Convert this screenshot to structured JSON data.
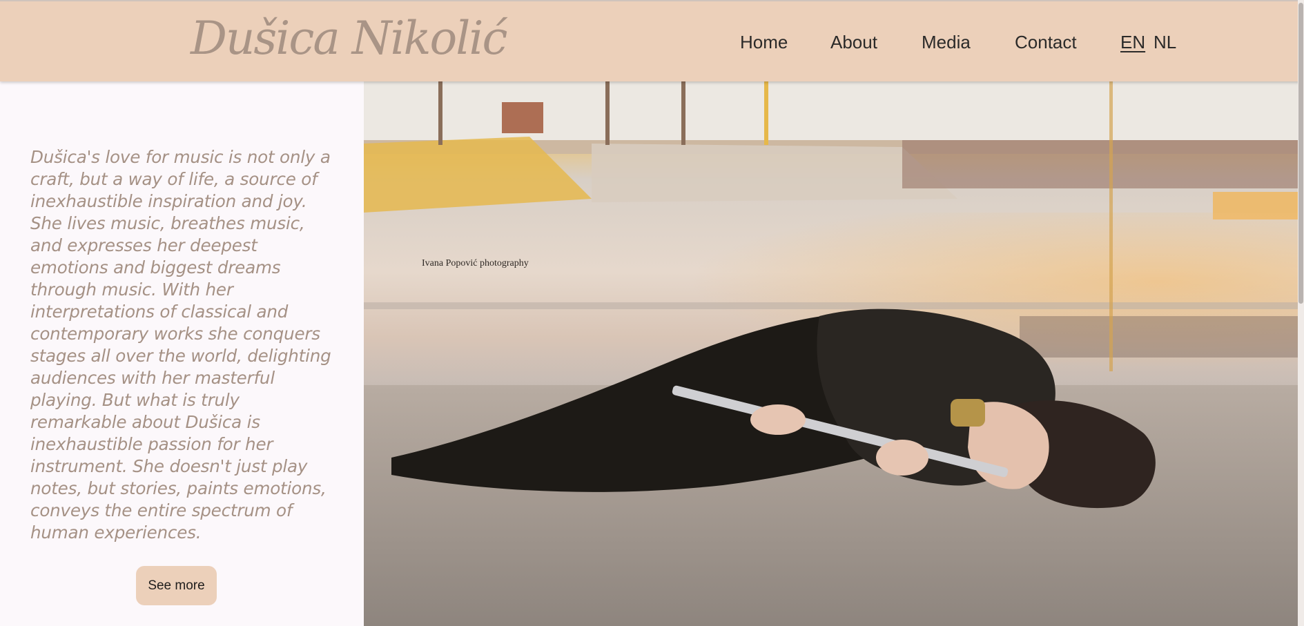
{
  "site": {
    "logo_text": "Dušica Nikolić"
  },
  "nav": {
    "items": [
      "Home",
      "About",
      "Media",
      "Contact"
    ],
    "languages": [
      "EN",
      "NL"
    ],
    "active_language": "EN"
  },
  "bio": {
    "text": "Dušica's love for music is not only a craft, but a way of life, a source of inexhaustible inspiration and joy. She lives music, breathes music, and expresses her deepest emotions and biggest dreams through music. With her interpretations of classical and contemporary works she conquers stages all over the world, delighting audiences with her masterful playing. But what is truly remarkable about Dušica is inexhaustible passion for her instrument. She doesn't just play notes, but stories, paints emotions, conveys the entire spectrum of human experiences.",
    "button_label": "See more"
  },
  "photo": {
    "credit": "Ivana Popović photography"
  },
  "colors": {
    "header_bg": "#ecd0ba",
    "logo": "#a99486",
    "bio_text": "#a59185",
    "page_bg": "#fcf8fb"
  }
}
